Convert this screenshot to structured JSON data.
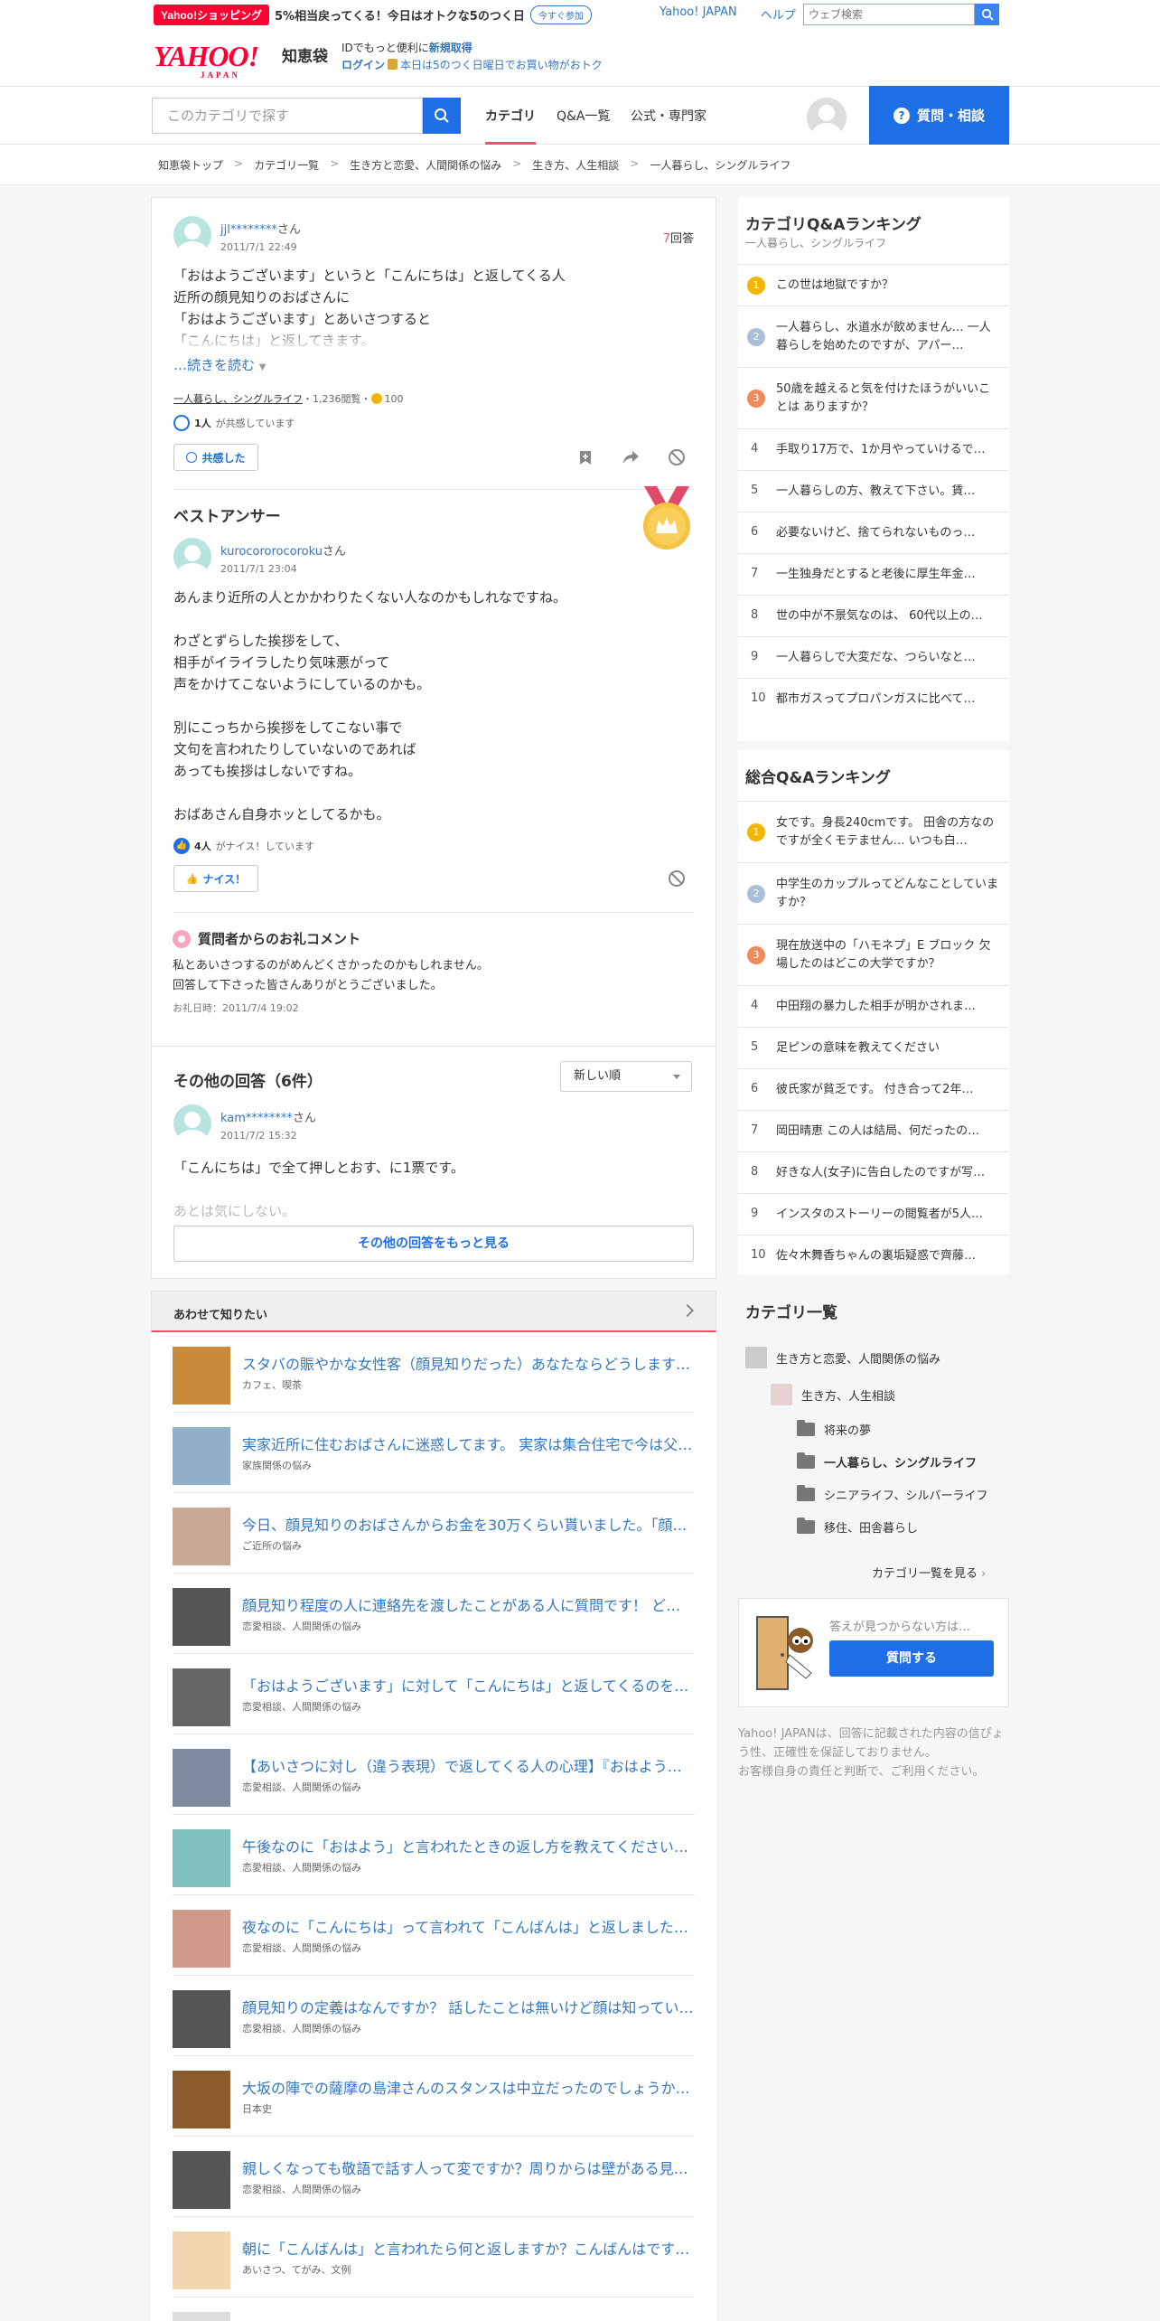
{
  "header": {
    "promo_logo": "Yahoo!ショッピング",
    "promo_text": "5%相当戻ってくる！今日はオトクな5のつく日",
    "promo_button": "今すぐ参加",
    "links": [
      "Yahoo! JAPAN",
      "ヘルプ"
    ],
    "web_search_placeholder": "ウェブ検索",
    "logo": "YAHOO!",
    "logo_sub": "JAPAN",
    "service": "知恵袋",
    "id_line1_prefix": "IDでもっと便利に",
    "id_line1_link": "新規取得",
    "id_line2_login": "ログイン",
    "id_line2_text": "本日は5のつく日曜日でお買い物がおトク"
  },
  "nav": {
    "search_placeholder": "このカテゴリで探す",
    "tabs": [
      "カテゴリ",
      "Q&A一覧",
      "公式・専門家"
    ],
    "ask_button": "質問・相談"
  },
  "breadcrumb": [
    "知恵袋トップ",
    "カテゴリ一覧",
    "生き方と恋愛、人間関係の悩み",
    "生き方、人生相談",
    "一人暮らし、シングルライフ"
  ],
  "question": {
    "user": "jjl********",
    "suffix": "さん",
    "date": "2011/7/1 22:49",
    "answer_count_num": "7",
    "answer_count_label": "回答",
    "body": "「おはようございます」というと「こんにちは」と返してくる人\n近所の顔見知りのおばさんに\n「おはようございます」とあいさつすると\n「こんにちは」と返してきます。",
    "read_more": "…続きを読む",
    "category": "一人暮らし、シングルライフ",
    "views": "・1,236閲覧・",
    "coins": "100",
    "empathy_count": "1人",
    "empathy_text": "が共感しています",
    "empathy_button": "共感した"
  },
  "best_answer": {
    "heading": "ベストアンサー",
    "user": "kurocororocoroku",
    "suffix": "さん",
    "date": "2011/7/1 23:04",
    "body": "あんまり近所の人とかかわりたくない人なのかもしれなですね。\n\nわざとずらした挨拶をして、\n相手がイライラしたり気味悪がって\n声をかけてこないようにしているのかも。\n\n別にこっちから挨拶をしてこない事で\n文句を言われたりしていないのであれば\nあっても挨拶はしないですね。\n\nおばあさん自身ホッとしてるかも。",
    "nice_count": "4人",
    "nice_text": "がナイス！しています",
    "nice_button": "ナイス！",
    "thanks_title": "質問者からのお礼コメント",
    "thanks_body": "私とあいさつするのがめんどくさかったのかもしれません。\n回答して下さった皆さんありがとうございました。",
    "thanks_date": "お礼日時：2011/7/4 19:02"
  },
  "other_answers": {
    "heading": "その他の回答（6件）",
    "sort": "新しい順",
    "user": "kam********",
    "suffix": "さん",
    "date": "2011/7/2 15:32",
    "body": "「こんにちは」で全て押しとおす、に1票です。",
    "body_faded": "あとは気にしない。",
    "more_button": "その他の回答をもっと見る"
  },
  "related": {
    "heading": "あわせて知りたい",
    "items": [
      {
        "title": "スタバの賑やかな女性客（顔見知りだった）あなたならどうします…",
        "cat": "カフェ、喫茶",
        "color": "#c98b3a"
      },
      {
        "title": "実家近所に住むおばさんに迷惑してます。 実家は集合住宅で今は父…",
        "cat": "家族関係の悩み",
        "color": "#8fb0c8"
      },
      {
        "title": "今日、顔見知りのおばさんからお金を30万くらい貰いました。「顔…",
        "cat": "ご近所の悩み",
        "color": "#c9a896"
      },
      {
        "title": "顔見知り程度の人に連絡先を渡したことがある人に質問です！ どう…",
        "cat": "恋愛相談、人間関係の悩み",
        "color": "#555"
      },
      {
        "title": "「おはようございます」に対して「こんにちは」と返してくるのを…",
        "cat": "恋愛相談、人間関係の悩み",
        "color": "#666"
      },
      {
        "title": "【あいさつに対し（違う表現）で返してくる人の心理】『おはよう…",
        "cat": "恋愛相談、人間関係の悩み",
        "color": "#7d8aa0"
      },
      {
        "title": "午後なのに「おはよう」と言われたときの返し方を教えてください…",
        "cat": "恋愛相談、人間関係の悩み",
        "color": "#7fc1c0"
      },
      {
        "title": "夜なのに「こんにちは」って言われて「こんばんは」と返しました…",
        "cat": "恋愛相談、人間関係の悩み",
        "color": "#d19a88"
      },
      {
        "title": "顔見知りの定義はなんですか？ 話したことは無いけど顔は知ってい…",
        "cat": "恋愛相談、人間関係の悩み",
        "color": "#555"
      },
      {
        "title": "大坂の陣での薩摩の島津さんのスタンスは中立だったのでしょうか…",
        "cat": "日本史",
        "color": "#8a5a2a"
      },
      {
        "title": "親しくなっても敬語で話す人って変ですか？周りからは壁がある見…",
        "cat": "恋愛相談、人間関係の悩み",
        "color": "#555"
      },
      {
        "title": "朝に「こんばんは」と言われたら何と返しますか？こんばんはです…",
        "cat": "あいさつ、てがみ、文例",
        "color": "#f2d6b0"
      },
      {
        "title": "",
        "cat": "",
        "color": "#ddd"
      }
    ]
  },
  "ranking_cat": {
    "title": "カテゴリQ&Aランキング",
    "sub": "一人暮らし、シングルライフ",
    "items": [
      {
        "n": "1",
        "t": "この世は地獄ですか？"
      },
      {
        "n": "2",
        "t": "一人暮らし、水道水が飲めません… 一人暮らしを始めたのですが、アパー…"
      },
      {
        "n": "3",
        "t": "50歳を越えると気を付けたほうがいいことは ありますか？"
      },
      {
        "n": "4",
        "t": "手取り17万で、1か月やっていけるで…"
      },
      {
        "n": "5",
        "t": "一人暮らしの方、教えて下さい。賃…"
      },
      {
        "n": "6",
        "t": "必要ないけど、捨てられないものっ…"
      },
      {
        "n": "7",
        "t": "一生独身だとすると老後に厚生年金…"
      },
      {
        "n": "8",
        "t": "世の中が不景気なのは、 60代以上の…"
      },
      {
        "n": "9",
        "t": "一人暮らしで大変だな、つらいなと…"
      },
      {
        "n": "10",
        "t": "都市ガスってプロパンガスに比べて…"
      }
    ]
  },
  "ranking_all": {
    "title": "総合Q&Aランキング",
    "items": [
      {
        "n": "1",
        "t": "女です。身長240cmです。 田舎の方なのですが全くモテません… いつも白…"
      },
      {
        "n": "2",
        "t": "中学生のカップルってどんなことしていますか？"
      },
      {
        "n": "3",
        "t": "現在放送中の「ハモネプ」E ブロック 欠場したのはどこの大学ですか？"
      },
      {
        "n": "4",
        "t": "中田翔の暴力した相手が明かされま…"
      },
      {
        "n": "5",
        "t": "足ピンの意味を教えてください"
      },
      {
        "n": "6",
        "t": "彼氏家が貧乏です。 付き合って2年…"
      },
      {
        "n": "7",
        "t": "岡田晴恵 この人は結局、何だったの…"
      },
      {
        "n": "8",
        "t": "好きな人(女子)に告白したのですが写…"
      },
      {
        "n": "9",
        "t": "インスタのストーリーの閲覧者が5人…"
      },
      {
        "n": "10",
        "t": "佐々木舞香ちゃんの裏垢疑惑で齊藤…"
      }
    ]
  },
  "category_list": {
    "title": "カテゴリ一覧",
    "lvl1": "生き方と恋愛、人間関係の悩み",
    "lvl2": "生き方、人生相談",
    "lvl3": [
      "将来の夢",
      "一人暮らし、シングルライフ",
      "シニアライフ、シルバーライフ",
      "移住、田舎暮らし"
    ],
    "more": "カテゴリ一覧を見る"
  },
  "help": {
    "text": "答えが見つからない方は…",
    "button": "質問する"
  },
  "disclaimer": "Yahoo! JAPANは、回答に記載された内容の信ぴょう性、正確性を保証しておりません。\nお客様自身の責任と判断で、ご利用ください。",
  "colors": {
    "accent": "#1e6fe6",
    "pink": "#ff4d6d",
    "gold": "#f2b600",
    "rank2": "#a9bfd8",
    "rank3": "#ef8a5a"
  }
}
